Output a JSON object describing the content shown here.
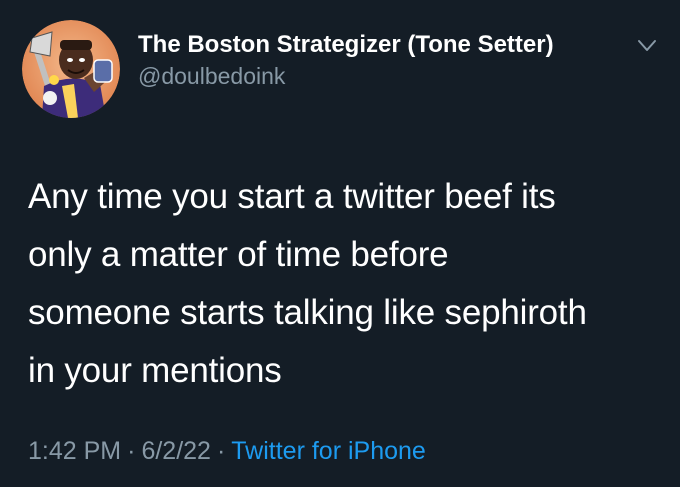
{
  "user": {
    "display_name": "The Boston Strategizer (Tone Setter)",
    "handle": "@doulbedoink"
  },
  "tweet": {
    "lines": [
      "Any time you start a twitter beef its",
      "only a matter of time before",
      "someone starts talking like sephiroth",
      "in your mentions"
    ],
    "time": "1:42 PM",
    "date": "6/2/22",
    "separator": "·",
    "source": "Twitter for iPhone"
  },
  "icons": {
    "menu": "chevron-down-icon",
    "avatar": "avatar"
  },
  "colors": {
    "background": "#141d26",
    "text": "#ffffff",
    "secondary": "#8899a6",
    "link": "#1d9bf0"
  }
}
